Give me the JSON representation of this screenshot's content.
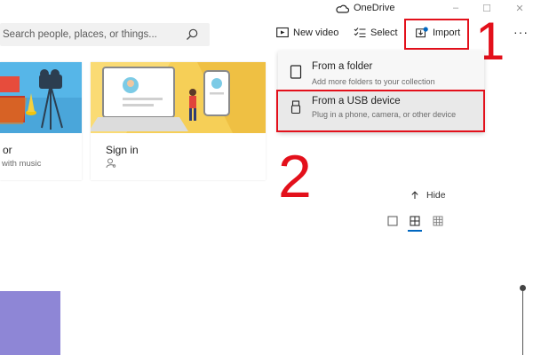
{
  "app": {
    "title": "OneDrive",
    "minimize": "–",
    "maximize": "☐",
    "close": "✕"
  },
  "search": {
    "placeholder": "Search people, places, or things..."
  },
  "toolbar": {
    "new_video": "New video",
    "select": "Select",
    "import": "Import",
    "more": "···"
  },
  "import_menu": {
    "items": [
      {
        "title": "From a folder",
        "desc": "Add more folders to your collection"
      },
      {
        "title": "From a USB device",
        "desc": "Plug in a phone, camera, or other device"
      }
    ]
  },
  "cards": [
    {
      "title": "or",
      "subtitle": "with music"
    },
    {
      "title": "Sign in"
    }
  ],
  "view": {
    "hide_label": "Hide"
  },
  "annotations": {
    "step1": "1",
    "step2": "2"
  },
  "colors": {
    "annotation_red": "#e3101b",
    "accent_blue": "#0067c0",
    "purple_tile": "#8e86d6"
  }
}
